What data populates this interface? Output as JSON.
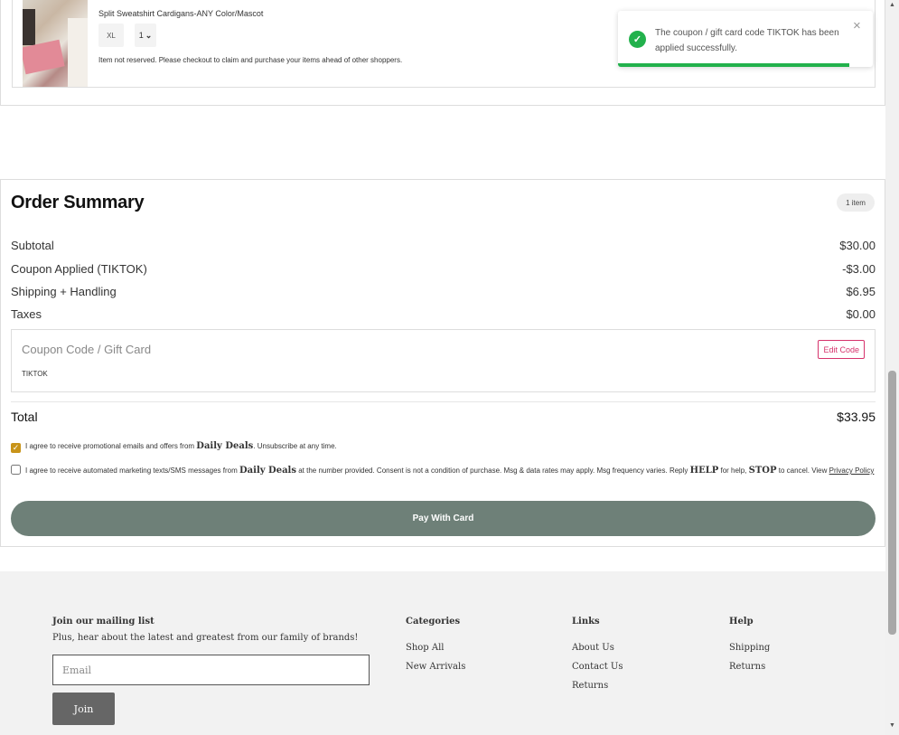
{
  "cart": {
    "item_name": "Split Sweatshirt Cardigans-ANY Color/Mascot",
    "size": "XL",
    "quantity": "1",
    "reserve_note": "Item not reserved. Please checkout to claim and purchase your items ahead of other shoppers."
  },
  "toast": {
    "message": "The coupon / gift card code TIKTOK has been applied successfully.",
    "close_glyph": "×",
    "check_glyph": "✓",
    "color": "#22b14c"
  },
  "summary": {
    "title": "Order Summary",
    "item_count": "1 item",
    "rows": [
      {
        "label": "Subtotal",
        "value": "$30.00"
      },
      {
        "label": "Coupon Applied (TIKTOK)",
        "value": "-$3.00"
      },
      {
        "label": "Shipping + Handling",
        "value": "$6.95"
      },
      {
        "label": "Taxes",
        "value": "$0.00"
      }
    ],
    "coupon_label": "Coupon Code / Gift Card",
    "coupon_code": "TIKTOK",
    "edit_code_label": "Edit Code",
    "total_label": "Total",
    "total_value": "$33.95",
    "email_consent": {
      "checked": true,
      "pre": "I agree to receive promotional emails and offers from ",
      "brand": "Daily Deals",
      "post": ". Unsubscribe at any time."
    },
    "sms_consent": {
      "checked": false,
      "pre": "I agree to receive automated marketing texts/SMS messages from ",
      "brand": "Daily Deals",
      "mid": " at the number provided. Consent is not a condition of purchase. Msg & data rates may apply. Msg frequency varies. Reply ",
      "help": "HELP",
      "mid2": " for help, ",
      "stop": "STOP",
      "end": " to cancel. View ",
      "link": "Privacy Policy"
    },
    "pay_label": "Pay With Card",
    "pay_color": "#6e8078"
  },
  "footer": {
    "mailing_title": "Join our mailing list",
    "mailing_sub": "Plus, hear about the latest and greatest from our family of brands!",
    "email_placeholder": "Email",
    "join_label": "Join",
    "categories": {
      "title": "Categories",
      "links": [
        "Shop All",
        "New Arrivals"
      ]
    },
    "links": {
      "title": "Links",
      "links": [
        "About Us",
        "Contact Us",
        "Returns"
      ]
    },
    "help": {
      "title": "Help",
      "links": [
        "Shipping",
        "Returns"
      ]
    }
  }
}
